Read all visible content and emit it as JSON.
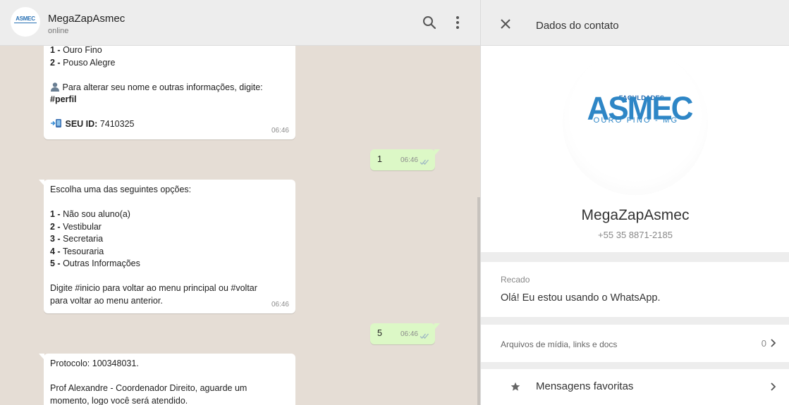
{
  "chat": {
    "name": "MegaZapAsmec",
    "status": "online",
    "avatar_logo": "ASMEC"
  },
  "messages": {
    "m1": {
      "lines": [
        "Ouro Fino",
        "Pouso Alegre"
      ],
      "nums": [
        "1 -",
        "2 -"
      ],
      "profile_text": "Para alterar seu nome e outras informações, digite:",
      "profile_cmd": "#perfil",
      "id_label": "SEU ID:",
      "id_value": "7410325",
      "time": "06:46"
    },
    "m2": {
      "text": "1",
      "time": "06:46"
    },
    "m3": {
      "intro": "Escolha uma das seguintes opções:",
      "nums": [
        "1 -",
        "2 -",
        "3 -",
        "4 -",
        "5 -"
      ],
      "options": [
        "Não sou aluno(a)",
        "Vestibular",
        "Secretaria",
        "Tesouraria",
        "Outras Informações"
      ],
      "footer_1": "Digite #inicio para voltar ao menu principal ou #voltar",
      "footer_2": "para voltar ao menu anterior.",
      "time": "06:46"
    },
    "m4": {
      "text": "5",
      "time": "06:46"
    },
    "m5": {
      "line_1": "Protocolo: 100348031.",
      "line_2": "Prof Alexandre - Coordenador Direito, aguarde um",
      "line_3": "momento, logo você será atendido."
    }
  },
  "contact": {
    "header_title": "Dados do contato",
    "logo": {
      "top": "FACULDADES",
      "main": "ASMEC",
      "sub": "OURO FINO - MG"
    },
    "name": "MegaZapAsmec",
    "phone": "+55 35 8871-2185",
    "about_label": "Recado",
    "about_text": "Olá! Eu estou usando o WhatsApp.",
    "media_label": "Arquivos de mídia, links e docs",
    "media_count": "0",
    "starred_label": "Mensagens favoritas"
  },
  "colors": {
    "chat_bg": "#e5ddd5",
    "outgoing_bubble": "#dcf8c6",
    "header_bg": "#ededed",
    "brand_blue": "#2e86c6",
    "read_ticks": "#9fb8c4"
  }
}
